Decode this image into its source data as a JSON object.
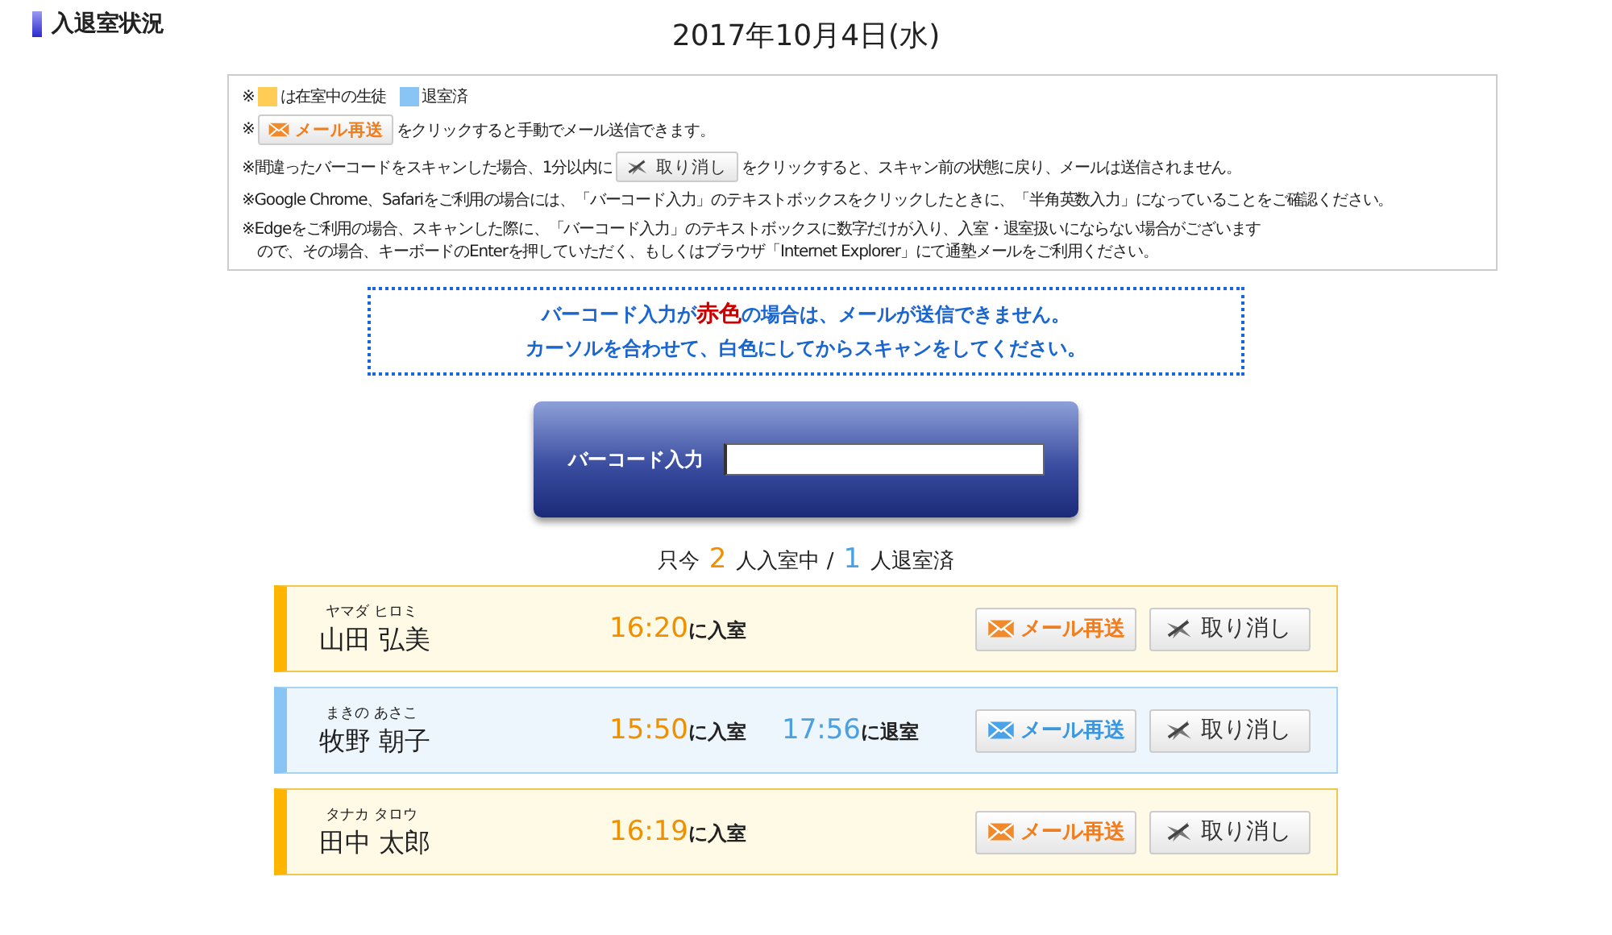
{
  "page_title": "入退室状況",
  "date": "2017年10月4日(水)",
  "notes": [
    {
      "parts": [
        {
          "kind": "text",
          "text": "※"
        },
        {
          "kind": "swatch",
          "color": "#ffcc55"
        },
        {
          "kind": "text",
          "text": "は在室中の生徒"
        },
        {
          "kind": "swatch",
          "color": "#88c4f4"
        },
        {
          "kind": "text",
          "text": "退室済"
        }
      ]
    },
    {
      "parts": [
        {
          "kind": "text",
          "text": "※"
        },
        {
          "kind": "mail",
          "text": "メール再送"
        },
        {
          "kind": "text",
          "text": "をクリックすると手動でメール送信できます。"
        }
      ]
    },
    {
      "parts": [
        {
          "kind": "text",
          "text": "※間違ったバーコードをスキャンした場合、1分以内に"
        },
        {
          "kind": "cancel",
          "text": "取り消し"
        },
        {
          "kind": "text",
          "text": "をクリックすると、スキャン前の状態に戻り、メールは送信されません。"
        }
      ]
    },
    {
      "parts": [
        {
          "kind": "text",
          "text": "※Google Chrome、Safariをご利用の場合には、「バーコード入力」のテキストボックスをクリックしたときに、「半角英数入力」になっていることをご確認ください。"
        }
      ]
    },
    {
      "parts": [
        {
          "kind": "text",
          "text": "※Edgeをご利用の場合、スキャンした際に、「バーコード入力」のテキストボックスに数字だけが入り、入室・退室扱いにならない場合がございます"
        }
      ]
    },
    {
      "parts": [
        {
          "kind": "text",
          "text": "　ので、その場合、キーボードのEnterを押していただく、もしくはブラウザ「Internet Explorer」にて通塾メールをご利用ください。"
        }
      ]
    }
  ],
  "notice": [
    [
      {
        "kind": "normal",
        "text": "バーコード入力が"
      },
      {
        "kind": "warning",
        "text": "赤色"
      },
      {
        "kind": "normal",
        "text": "の場合は、メールが送信できません。"
      }
    ],
    [
      {
        "kind": "normal",
        "text": "カーソルを合わせて、白色にしてからスキャンをしてください。"
      }
    ]
  ],
  "barcode": {
    "label": "バーコード入力"
  },
  "counter": {
    "prefix": "只今",
    "in_count": "2",
    "in_label": "人入室中 /",
    "out_count": "1",
    "out_label": "人退室済"
  },
  "students": [
    {
      "kind": "in",
      "reading": "ヤマダ ヒロミ",
      "name": "山田 弘美",
      "entry_time": "16:20",
      "entry_label": "に入室",
      "mail_button": "メール再送",
      "cancel_button": "取り消し"
    },
    {
      "kind": "out",
      "reading": "まきの あさこ",
      "name": "牧野 朝子",
      "entry_time": "15:50",
      "entry_label": "に入室",
      "exit_time": "17:56",
      "exit_label": "に退室",
      "mail_button": "メール再送",
      "cancel_button": "取り消し"
    },
    {
      "kind": "in",
      "reading": "タナカ タロウ",
      "name": "田中 太郎",
      "entry_time": "16:19",
      "entry_label": "に入室",
      "mail_button": "メール再送",
      "cancel_button": "取り消し"
    }
  ]
}
